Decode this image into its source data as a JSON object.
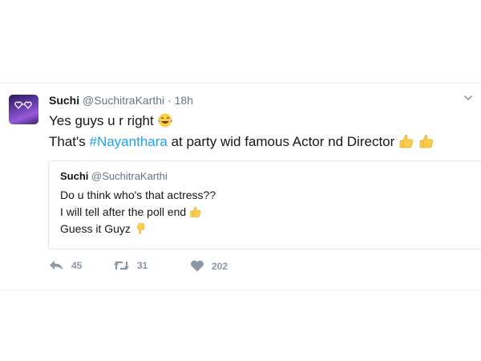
{
  "tweet": {
    "author_name": "Suchi",
    "author_handle": "@SuchitraKarthi",
    "separator": "·",
    "time": "18h",
    "line1": "Yes guys u r right",
    "line1_emoji": "face-with-tears-of-joy",
    "line2_before": "That's ",
    "line2_hashtag": "#Nayanthara",
    "line2_after": " at party wid famous Actor nd Director",
    "line2_emoji": [
      "thumbs-up",
      "thumbs-up"
    ]
  },
  "quoted_tweet": {
    "author_name": "Suchi",
    "author_handle": "@SuchitraKarthi",
    "line1": "Do u think who's that actress??",
    "line2": "I will tell after the poll end",
    "line2_emoji": "thumbs-up",
    "line3": "Guess it Guyz",
    "line3_emoji": "pointing-down"
  },
  "actions": {
    "reply_count": "45",
    "retweet_count": "31",
    "like_count": "202"
  },
  "colors": {
    "text": "#14171a",
    "muted": "#657786",
    "hashtag": "#1da1f2",
    "action_icon": "#8b98a5",
    "border": "#e1e8ed",
    "emoji": "#ffcc4d"
  },
  "icons": [
    "avatar-sunglasses-icon",
    "chevron-down-icon",
    "reply-icon",
    "retweet-icon",
    "heart-icon"
  ]
}
